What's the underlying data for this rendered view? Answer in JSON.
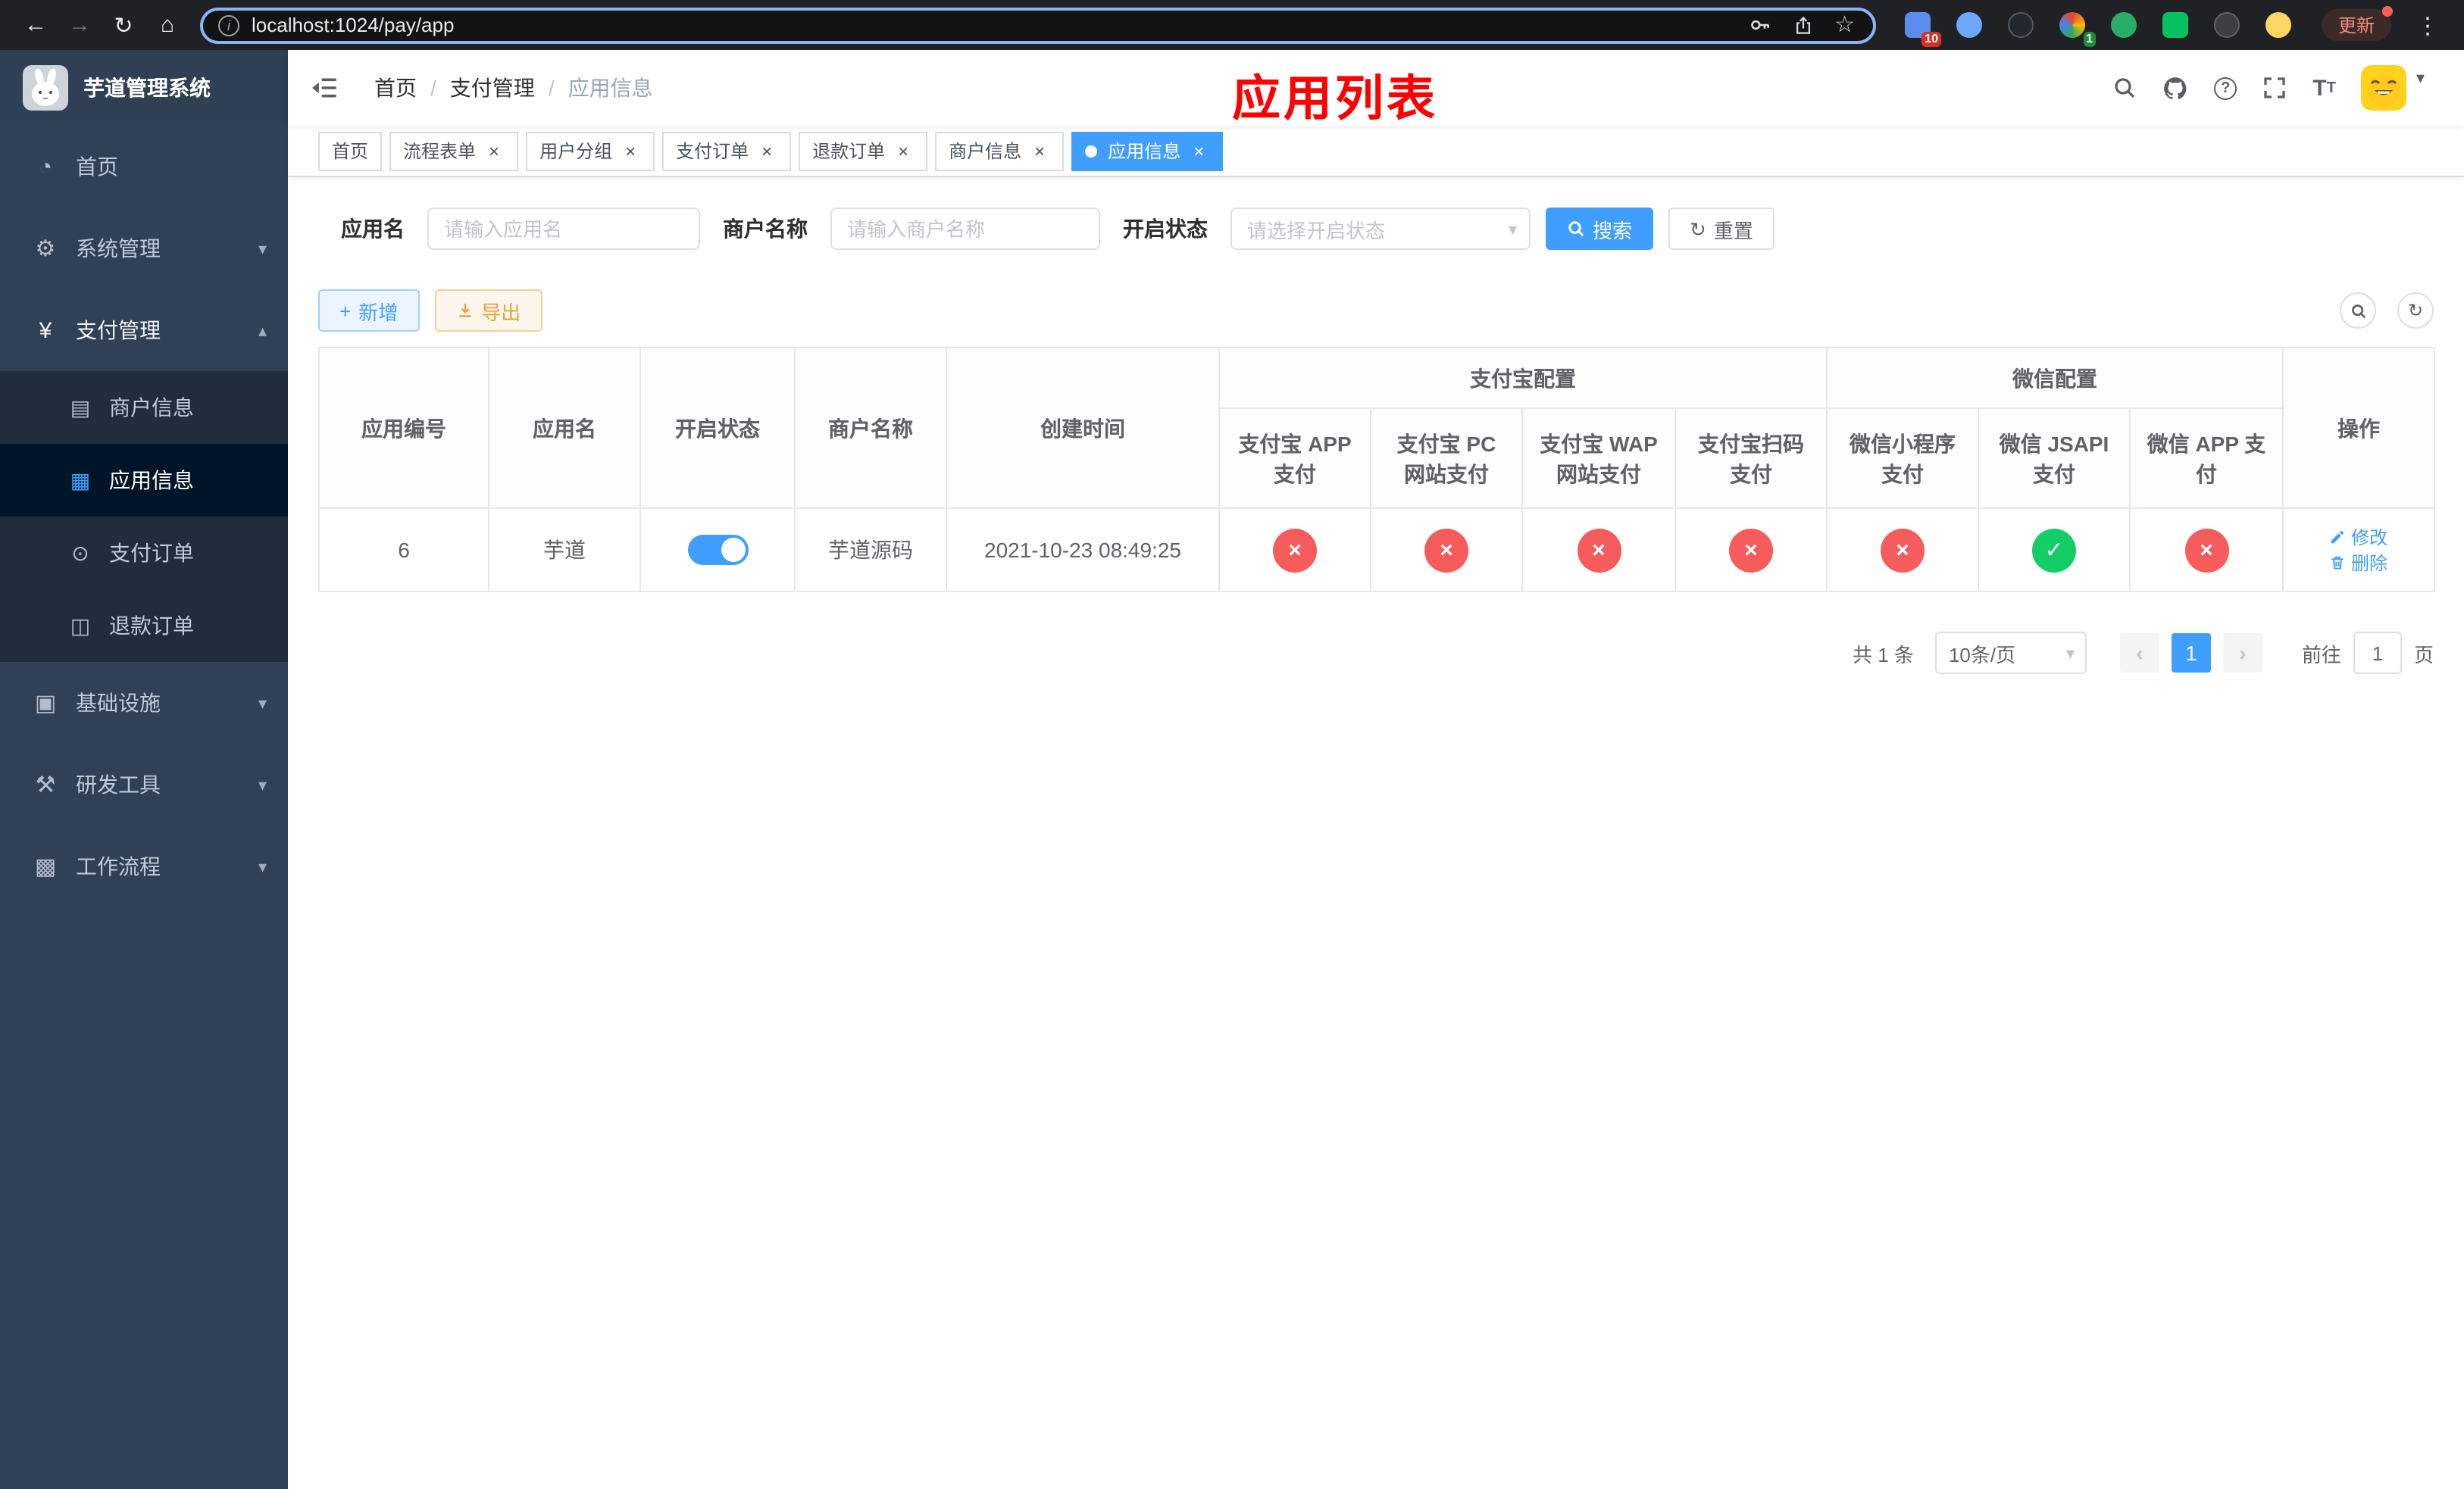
{
  "icons": {
    "back": "←",
    "forward": "→",
    "reload": "↻",
    "home": "⌂",
    "info": "i",
    "star": "☆",
    "kebab": "⋮",
    "close": "×",
    "cross": "×",
    "check": "✓",
    "caret_down": "▾",
    "caret_up": "▴",
    "chevron_left": "‹",
    "chevron_right": "›",
    "plus": "+",
    "refresh": "↻",
    "question": "?",
    "font_large": "T",
    "font_small": "T"
  },
  "browser": {
    "url": "localhost:1024/pay/app",
    "update_label": "更新",
    "ext_badge_grid": "10",
    "ext_badge_profile": "1"
  },
  "sidebar": {
    "title": "芋道管理系统",
    "items": [
      {
        "icon": "◔",
        "label": "首页"
      },
      {
        "icon": "⚙",
        "label": "系统管理"
      },
      {
        "icon": "¥",
        "label": "支付管理",
        "children": [
          {
            "icon": "▤",
            "label": "商户信息"
          },
          {
            "icon": "▦",
            "label": "应用信息"
          },
          {
            "icon": "⊙",
            "label": "支付订单"
          },
          {
            "icon": "◫",
            "label": "退款订单"
          }
        ]
      },
      {
        "icon": "▣",
        "label": "基础设施"
      },
      {
        "icon": "⚒",
        "label": "研发工具"
      },
      {
        "icon": "▩",
        "label": "工作流程"
      }
    ]
  },
  "header": {
    "sep": "/",
    "breadcrumb": [
      "首页",
      "支付管理",
      "应用信息"
    ],
    "title": "应用列表"
  },
  "tabs": [
    {
      "label": "首页"
    },
    {
      "label": "流程表单"
    },
    {
      "label": "用户分组"
    },
    {
      "label": "支付订单"
    },
    {
      "label": "退款订单"
    },
    {
      "label": "商户信息"
    },
    {
      "label": "应用信息"
    }
  ],
  "filters": {
    "app_name_label": "应用名",
    "app_name_placeholder": "请输入应用名",
    "merchant_label": "商户名称",
    "merchant_placeholder": "请输入商户名称",
    "status_label": "开启状态",
    "status_placeholder": "请选择开启状态",
    "search_label": "搜索",
    "reset_label": "重置"
  },
  "toolbar": {
    "add_label": "新增",
    "export_label": "导出"
  },
  "table": {
    "columns": [
      "应用编号",
      "应用名",
      "开启状态",
      "商户名称",
      "创建时间"
    ],
    "groups": [
      {
        "label": "支付宝配置",
        "children": [
          "支付宝 APP 支付",
          "支付宝 PC 网站支付",
          "支付宝 WAP 网站支付",
          "支付宝扫码支付"
        ]
      },
      {
        "label": "微信配置",
        "children": [
          "微信小程序支付",
          "微信 JSAPI 支付",
          "微信 APP 支付"
        ]
      }
    ],
    "ops_label": "操作",
    "row": {
      "id": "6",
      "name": "芋道",
      "enabled": true,
      "merchant": "芋道源码",
      "created": "2021-10-23 08:49:25",
      "pay_configs": [
        "closed",
        "closed",
        "closed",
        "closed",
        "closed",
        "open",
        "closed"
      ],
      "edit_label": "修改",
      "delete_label": "删除"
    }
  },
  "pagination": {
    "total": "共 1 条",
    "page_size": "10条/页",
    "page": "1",
    "goto_label": "前往",
    "goto_value": "1",
    "page_unit": "页"
  }
}
